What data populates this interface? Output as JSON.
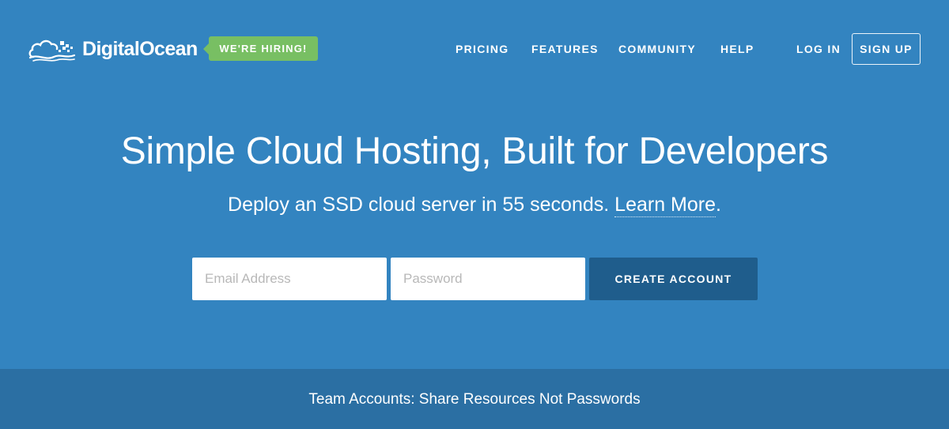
{
  "brand": {
    "logo_text": "DigitalOcean",
    "logo_icon": "cloud-icon",
    "hiring_badge": "WE'RE HIRING!"
  },
  "nav": {
    "items": [
      {
        "label": "PRICING"
      },
      {
        "label": "FEATURES"
      },
      {
        "label": "COMMUNITY"
      },
      {
        "label": "HELP"
      }
    ],
    "login": "LOG IN",
    "signup": "SIGN UP"
  },
  "hero": {
    "title": "Simple Cloud Hosting, Built for Developers",
    "subtitle_prefix": "Deploy an SSD cloud server in 55 seconds. ",
    "learn_more": "Learn More",
    "subtitle_suffix": "."
  },
  "signup_form": {
    "email_placeholder": "Email Address",
    "email_value": "",
    "password_placeholder": "Password",
    "password_value": "",
    "submit_label": "CREATE ACCOUNT"
  },
  "banner": {
    "text": "Team Accounts: Share Resources Not Passwords"
  },
  "colors": {
    "background": "#3384c0",
    "hiring_badge": "#78bf63",
    "primary_button": "#1f5d8c",
    "banner": "#2b6fa3"
  }
}
